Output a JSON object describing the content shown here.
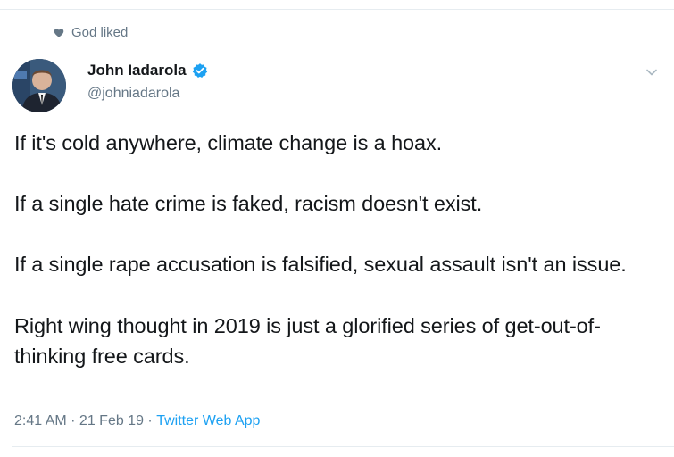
{
  "social_context": {
    "icon": "heart-icon",
    "text": "God liked"
  },
  "author": {
    "display_name": "John Iadarola",
    "handle": "@johniadarola",
    "verified": true,
    "avatar_icon": "avatar"
  },
  "tweet": {
    "paragraphs": [
      "If it's cold anywhere, climate change is a hoax.",
      "If a single hate crime is faked, racism doesn't exist.",
      "If a single rape accusation is falsified, sexual assault isn't an issue.",
      "Right wing thought in 2019 is just a glorified series of get-out-of-thinking free cards."
    ]
  },
  "meta": {
    "time": "2:41 AM",
    "separator": " · ",
    "date": "21 Feb 19",
    "source": "Twitter Web App"
  },
  "colors": {
    "text_primary": "#14171a",
    "text_secondary": "#657786",
    "link": "#1da1f2",
    "verified_badge": "#1da1f2",
    "divider": "#e6ecf0"
  }
}
